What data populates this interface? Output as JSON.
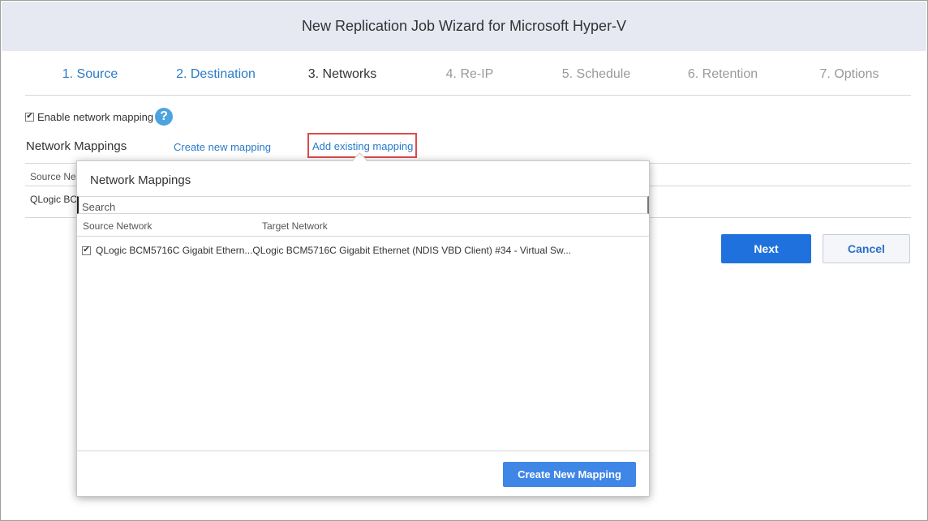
{
  "window": {
    "title": "New Replication Job Wizard for Microsoft Hyper-V"
  },
  "steps": [
    {
      "label": "1. Source",
      "state": "done"
    },
    {
      "label": "2. Destination",
      "state": "done"
    },
    {
      "label": "3. Networks",
      "state": "current"
    },
    {
      "label": "4. Re-IP",
      "state": "future"
    },
    {
      "label": "5. Schedule",
      "state": "future"
    },
    {
      "label": "6. Retention",
      "state": "future"
    },
    {
      "label": "7. Options",
      "state": "future"
    }
  ],
  "enable_mapping": {
    "label": "Enable network mapping",
    "checked": true,
    "help_icon": "question-icon"
  },
  "network_mappings": {
    "title": "Network Mappings",
    "create_link": "Create new mapping",
    "add_link": "Add existing mapping",
    "bg_header_source": "Source Ne",
    "bg_row_source": "QLogic BC"
  },
  "popup": {
    "title": "Network Mappings",
    "search_placeholder": "Search",
    "columns": {
      "source": "Source Network",
      "target": "Target Network"
    },
    "rows": [
      {
        "checked": true,
        "text": "QLogic BCM5716C Gigabit Ethern...QLogic BCM5716C Gigabit Ethernet (NDIS VBD Client) #34 - Virtual Sw..."
      }
    ],
    "create_button": "Create New Mapping"
  },
  "buttons": {
    "next": "Next",
    "cancel": "Cancel"
  },
  "colors": {
    "link": "#2a7ac7",
    "primary": "#1f72dd",
    "highlight": "#e04b4b",
    "titlebar": "#e6e9f2"
  }
}
